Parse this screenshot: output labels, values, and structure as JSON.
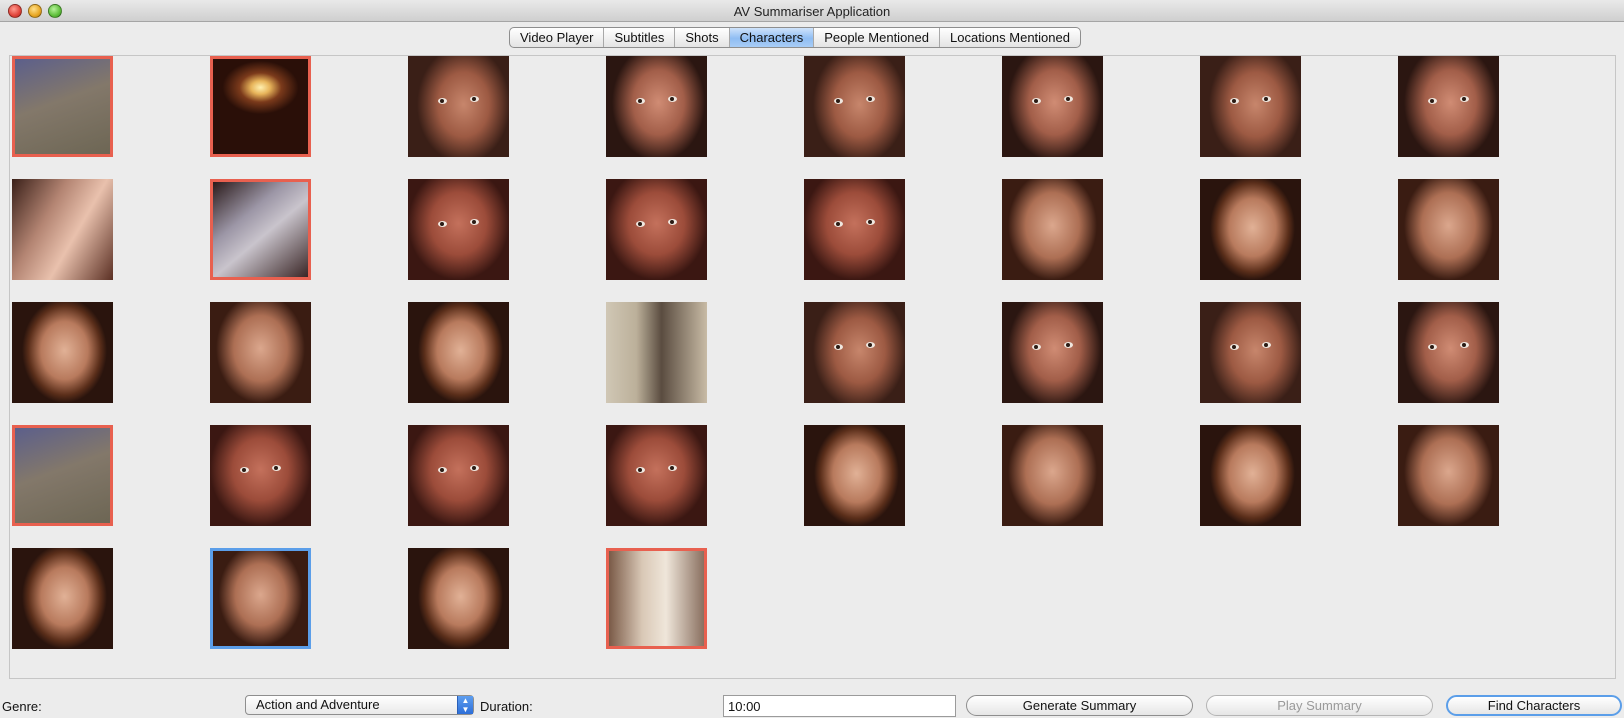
{
  "window": {
    "title": "AV Summariser Application"
  },
  "tabs": [
    {
      "label": "Video Player"
    },
    {
      "label": "Subtitles"
    },
    {
      "label": "Shots"
    },
    {
      "label": "Characters",
      "active": true
    },
    {
      "label": "People Mentioned"
    },
    {
      "label": "Locations Mentioned"
    }
  ],
  "characters": {
    "thumbnails": [
      {
        "row": 1,
        "kind": "blurred shot",
        "selection": "red"
      },
      {
        "row": 1,
        "kind": "chandelier",
        "selection": "red"
      },
      {
        "row": 1,
        "kind": "close-up face",
        "selection": "none"
      },
      {
        "row": 1,
        "kind": "close-up face",
        "selection": "none"
      },
      {
        "row": 1,
        "kind": "close-up face",
        "selection": "none"
      },
      {
        "row": 1,
        "kind": "close-up face",
        "selection": "none"
      },
      {
        "row": 1,
        "kind": "close-up face",
        "selection": "none"
      },
      {
        "row": 1,
        "kind": "close-up face",
        "selection": "none"
      },
      {
        "row": 2,
        "kind": "hand",
        "selection": "none"
      },
      {
        "row": 2,
        "kind": "blurred shot",
        "selection": "red"
      },
      {
        "row": 2,
        "kind": "surprised face",
        "selection": "none"
      },
      {
        "row": 2,
        "kind": "surprised face",
        "selection": "none"
      },
      {
        "row": 2,
        "kind": "surprised face",
        "selection": "none"
      },
      {
        "row": 2,
        "kind": "red-haired face",
        "selection": "none"
      },
      {
        "row": 2,
        "kind": "red-haired face",
        "selection": "none"
      },
      {
        "row": 2,
        "kind": "red-haired face",
        "selection": "none"
      },
      {
        "row": 3,
        "kind": "red-haired face",
        "selection": "none"
      },
      {
        "row": 3,
        "kind": "red-haired face",
        "selection": "none"
      },
      {
        "row": 3,
        "kind": "red-haired face",
        "selection": "none"
      },
      {
        "row": 3,
        "kind": "man",
        "selection": "none"
      },
      {
        "row": 3,
        "kind": "close-up face",
        "selection": "none"
      },
      {
        "row": 3,
        "kind": "close-up face",
        "selection": "none"
      },
      {
        "row": 3,
        "kind": "close-up face",
        "selection": "none"
      },
      {
        "row": 3,
        "kind": "close-up face",
        "selection": "none"
      },
      {
        "row": 4,
        "kind": "blurred shot",
        "selection": "red"
      },
      {
        "row": 4,
        "kind": "surprised face",
        "selection": "none"
      },
      {
        "row": 4,
        "kind": "surprised face",
        "selection": "none"
      },
      {
        "row": 4,
        "kind": "surprised face",
        "selection": "none"
      },
      {
        "row": 4,
        "kind": "red-haired face",
        "selection": "none"
      },
      {
        "row": 4,
        "kind": "red-haired face",
        "selection": "none"
      },
      {
        "row": 4,
        "kind": "red-haired face",
        "selection": "none"
      },
      {
        "row": 4,
        "kind": "red-haired face",
        "selection": "none"
      },
      {
        "row": 5,
        "kind": "red-haired face",
        "selection": "none"
      },
      {
        "row": 5,
        "kind": "red-haired face",
        "selection": "blue"
      },
      {
        "row": 5,
        "kind": "red-haired face",
        "selection": "none"
      },
      {
        "row": 5,
        "kind": "door",
        "selection": "red"
      }
    ]
  },
  "controls": {
    "genre_label": "Genre:",
    "genre_value": "Action and Adventure",
    "duration_label": "Duration:",
    "duration_value": "10:00",
    "generate_label": "Generate Summary",
    "play_label": "Play Summary",
    "find_label": "Find Characters"
  },
  "colors": {
    "selection_red": "#e8604f",
    "selection_blue": "#5b9ee9",
    "active_tab": "#a8cdf6"
  }
}
